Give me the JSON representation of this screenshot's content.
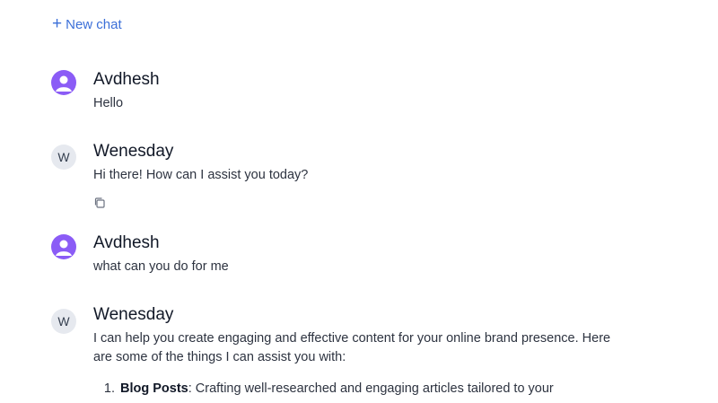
{
  "toolbar": {
    "new_chat_label": "New chat"
  },
  "messages": [
    {
      "author": "Avdhesh",
      "role": "user",
      "text": "Hello"
    },
    {
      "author": "Wenesday",
      "role": "assistant",
      "avatar_letter": "W",
      "text": "Hi there! How can I assist you today?"
    },
    {
      "author": "Avdhesh",
      "role": "user",
      "text": "what can you do for me"
    },
    {
      "author": "Wenesday",
      "role": "assistant",
      "avatar_letter": "W",
      "text": "I can help you create engaging and effective content for your online brand presence. Here are some of the things I can assist you with:",
      "list": [
        {
          "title": "Blog Posts",
          "text": ": Crafting well-researched and engaging articles tailored to your"
        }
      ]
    }
  ],
  "colors": {
    "accent": "#3b6fd8",
    "user_avatar": "#8b5cf6",
    "bot_avatar": "#e6e9ef"
  },
  "icons": [
    "plus-icon",
    "user-avatar-icon",
    "copy-icon"
  ]
}
